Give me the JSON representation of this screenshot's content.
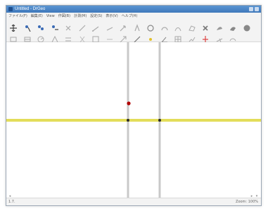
{
  "window": {
    "title": "Untitled - DrGeo"
  },
  "menu": [
    "ファイル(F)",
    "編集(E)",
    "View",
    "作図(B)",
    "計測(M)",
    "設定(S)",
    "表示(V)",
    "ヘルプ(H)"
  ],
  "toolbar1": [
    {
      "name": "move-icon",
      "interactable": true
    },
    {
      "name": "point-icon",
      "interactable": true
    },
    {
      "name": "midpoint-icon",
      "interactable": true
    },
    {
      "name": "intersection-icon",
      "interactable": true
    },
    {
      "name": "cross-icon",
      "interactable": true
    },
    {
      "name": "line-icon",
      "interactable": true
    },
    {
      "name": "ray-icon",
      "interactable": true
    },
    {
      "name": "segment-icon",
      "interactable": true
    },
    {
      "name": "vector-icon",
      "interactable": true
    },
    {
      "name": "compass-icon",
      "interactable": true
    },
    {
      "name": "circle-icon",
      "interactable": true
    },
    {
      "name": "arc-icon",
      "interactable": true
    },
    {
      "name": "locus-icon",
      "interactable": true
    },
    {
      "name": "polygon-icon",
      "interactable": true
    },
    {
      "name": "delete-icon",
      "interactable": true
    },
    {
      "name": "fill-icon",
      "interactable": true
    },
    {
      "name": "color-icon",
      "interactable": true
    },
    {
      "name": "circle-fill-icon",
      "interactable": true
    }
  ],
  "toolbar2": [
    {
      "name": "parallel-icon"
    },
    {
      "name": "perpendicular-icon"
    },
    {
      "name": "reflection-icon"
    },
    {
      "name": "symmetry-icon"
    },
    {
      "name": "translation-icon"
    },
    {
      "name": "rotation-icon"
    },
    {
      "name": "scale-icon"
    },
    {
      "name": "distance-icon"
    },
    {
      "name": "slope-icon"
    },
    {
      "name": "pencil-icon"
    },
    {
      "name": "dot-icon"
    },
    {
      "name": "angle-icon"
    },
    {
      "name": "table-icon"
    },
    {
      "name": "script-icon"
    },
    {
      "name": "bisector-icon"
    },
    {
      "name": "vector-sum-icon"
    },
    {
      "name": "equation-icon"
    }
  ],
  "statusbar": {
    "left": "1.7.",
    "right": "Zoom: 100%"
  },
  "colors": {
    "line": "#e3dd5a",
    "point": "#b00000",
    "dark_point": "#2a2a2a",
    "vertical_line": "#c9c9c9"
  }
}
